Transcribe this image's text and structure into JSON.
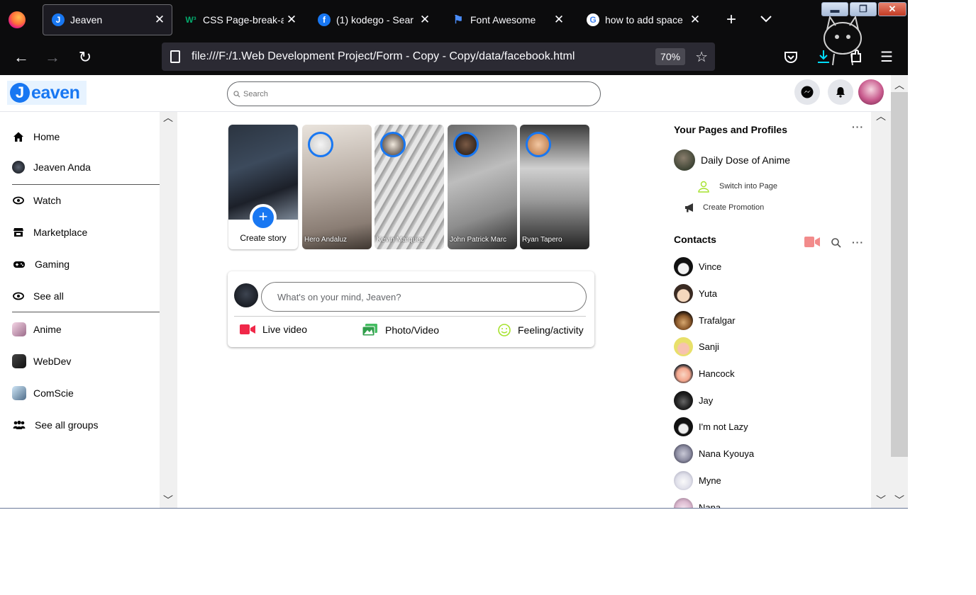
{
  "browser": {
    "tabs": [
      {
        "title": "Jeaven",
        "active": true
      },
      {
        "title": "CSS Page-break-a",
        "active": false
      },
      {
        "title": "(1) kodego - Sear",
        "active": false
      },
      {
        "title": "Font Awesome",
        "active": false
      },
      {
        "title": "how to add space",
        "active": false
      }
    ],
    "url": "file:///F:/1.Web Development Project/Form - Copy - Copy/data/facebook.html",
    "zoom": "70%"
  },
  "site": {
    "logo_letter": "J",
    "logo_text": "eaven",
    "search_placeholder": "Search"
  },
  "sidebar": {
    "items": [
      {
        "label": "Home",
        "icon": "home-icon"
      },
      {
        "label": "Jeaven Anda",
        "icon": "profile-avatar"
      },
      {
        "label": "Watch",
        "icon": "watch-icon"
      },
      {
        "label": "Marketplace",
        "icon": "store-icon"
      },
      {
        "label": "Gaming",
        "icon": "gamepad-icon"
      },
      {
        "label": "See all",
        "icon": "eye-icon"
      }
    ],
    "groups": [
      {
        "label": "Anime"
      },
      {
        "label": "WebDev"
      },
      {
        "label": "ComScie"
      },
      {
        "label": "See all groups"
      }
    ]
  },
  "stories": {
    "create_label": "Create story",
    "items": [
      {
        "name": "Hero Andaluz"
      },
      {
        "name": "Kevin Marquez"
      },
      {
        "name": "John Patrick Marc"
      },
      {
        "name": "Ryan Tapero"
      }
    ]
  },
  "composer": {
    "placeholder": "What's on your mind, Jeaven?",
    "actions": [
      {
        "label": "Live video",
        "color": "#f02849"
      },
      {
        "label": "Photo/Video",
        "color": "#45bd62"
      },
      {
        "label": "Feeling/activity",
        "color": "#a6e22e"
      }
    ]
  },
  "pages": {
    "heading": "Your Pages and Profiles",
    "page_name": "Daily Dose of Anime",
    "switch_label": "Switch into Page",
    "promo_label": "Create Promotion"
  },
  "contacts": {
    "heading": "Contacts",
    "items": [
      {
        "name": "Vince"
      },
      {
        "name": "Yuta"
      },
      {
        "name": "Trafalgar"
      },
      {
        "name": "Sanji"
      },
      {
        "name": "Hancock"
      },
      {
        "name": "Jay"
      },
      {
        "name": "I'm not Lazy"
      },
      {
        "name": "Nana Kyouya"
      },
      {
        "name": "Myne"
      },
      {
        "name": "Nana"
      }
    ]
  }
}
